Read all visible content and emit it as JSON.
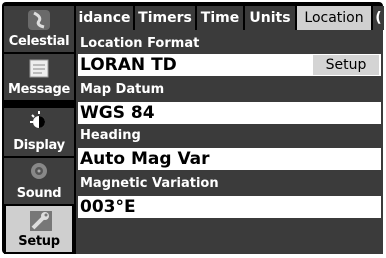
{
  "sidebar": {
    "items": [
      {
        "label": "Celestial",
        "icon": "celestial-icon"
      },
      {
        "label": "Message",
        "icon": "message-icon"
      },
      {
        "label": "Display",
        "icon": "display-icon"
      },
      {
        "label": "Sound",
        "icon": "sound-icon"
      },
      {
        "label": "Setup",
        "icon": "setup-icon",
        "active": true
      }
    ]
  },
  "tabs": [
    {
      "label": "idance"
    },
    {
      "label": "Timers"
    },
    {
      "label": "Time"
    },
    {
      "label": "Units"
    },
    {
      "label": "Location",
      "active": true
    },
    {
      "label": "("
    }
  ],
  "fields": {
    "location_format": {
      "label": "Location Format",
      "value": "LORAN TD",
      "button": "Setup"
    },
    "map_datum": {
      "label": "Map Datum",
      "value": "WGS 84"
    },
    "heading": {
      "label": "Heading",
      "value": "Auto Mag Var"
    },
    "magnetic_variation": {
      "label": "Magnetic Variation",
      "value": "003°E"
    }
  },
  "colors": {
    "panel": "#3b3b3b",
    "active_tab": "#d0d0d0",
    "background": "#000000"
  }
}
